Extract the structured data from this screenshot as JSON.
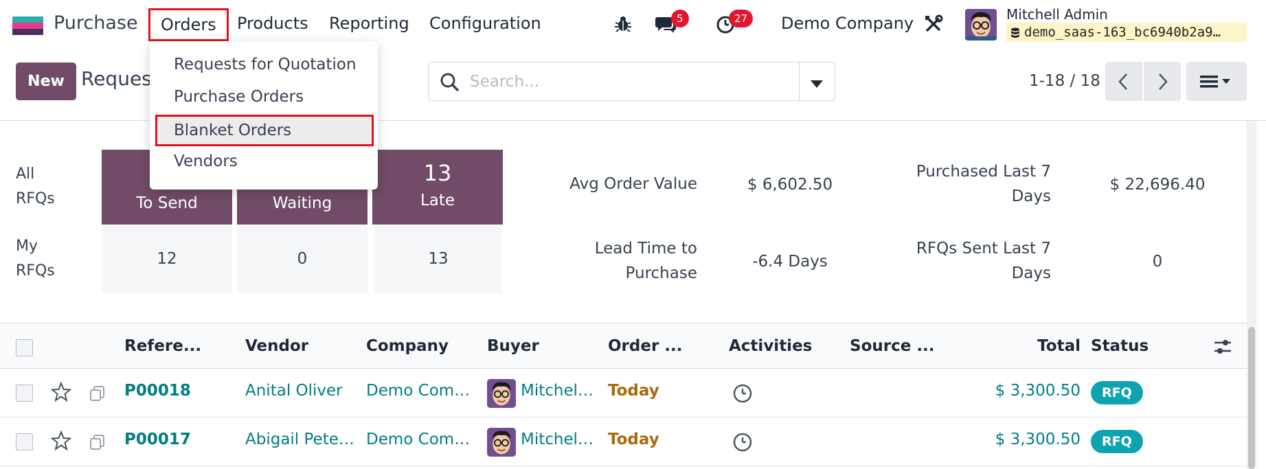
{
  "navbar": {
    "app_name": "Purchase",
    "menu": [
      "Orders",
      "Products",
      "Reporting",
      "Configuration"
    ],
    "messages_count": "5",
    "activities_count": "27",
    "company": "Demo Company",
    "user_name": "Mitchell Admin",
    "db_name": "demo_saas-163_bc6940b2a9…"
  },
  "dropdown": {
    "items": [
      "Requests for Quotation",
      "Purchase Orders",
      "Blanket Orders",
      "Vendors"
    ]
  },
  "control_panel": {
    "new_label": "New",
    "breadcrumb": "Reques",
    "search_placeholder": "Search...",
    "pager": "1-18 / 18"
  },
  "dashboard": {
    "all_label": "All RFQs",
    "my_label": "My RFQs",
    "tiles": [
      {
        "label": "To Send",
        "my": "12"
      },
      {
        "label": "Waiting",
        "my": "0"
      },
      {
        "value": "13",
        "label": "Late",
        "my": "13"
      }
    ],
    "kpis": {
      "avg_order_label": "Avg Order Value",
      "avg_order_value": "$ 6,602.50",
      "purchased_label": "Purchased Last 7 Days",
      "purchased_value": "$ 22,696.40",
      "lead_time_label": "Lead Time to Purchase",
      "lead_time_value": "-6.4 Days",
      "rfqs_sent_label": "RFQs Sent Last 7 Days",
      "rfqs_sent_value": "0"
    }
  },
  "table": {
    "headers": [
      "Refere...",
      "Vendor",
      "Company",
      "Buyer",
      "Order ...",
      "Activities",
      "Source ...",
      "Total",
      "Status"
    ],
    "rows": [
      {
        "reference": "P00018",
        "vendor": "Anital Oliver",
        "company": "Demo Com…",
        "buyer": "Mitchel…",
        "order_date": "Today",
        "total": "$ 3,300.50",
        "status": "RFQ"
      },
      {
        "reference": "P00017",
        "vendor": "Abigail Pete…",
        "company": "Demo Com…",
        "buyer": "Mitchel…",
        "order_date": "Today",
        "total": "$ 3,300.50",
        "status": "RFQ"
      }
    ]
  },
  "colors": {
    "brand": "#714b67",
    "link": "#017e84",
    "today": "#a66b0d",
    "status_rfq": "#0fa3b1",
    "badge": "#e3172c",
    "highlight_box": "#e3111c"
  },
  "icons": [
    "bug-icon",
    "chat-icon",
    "clock-icon",
    "tools-icon",
    "database-icon",
    "search-icon",
    "caret-down-icon",
    "chevron-left-icon",
    "chevron-right-icon",
    "list-view-icon",
    "star-icon",
    "copy-icon",
    "settings-sliders-icon"
  ]
}
